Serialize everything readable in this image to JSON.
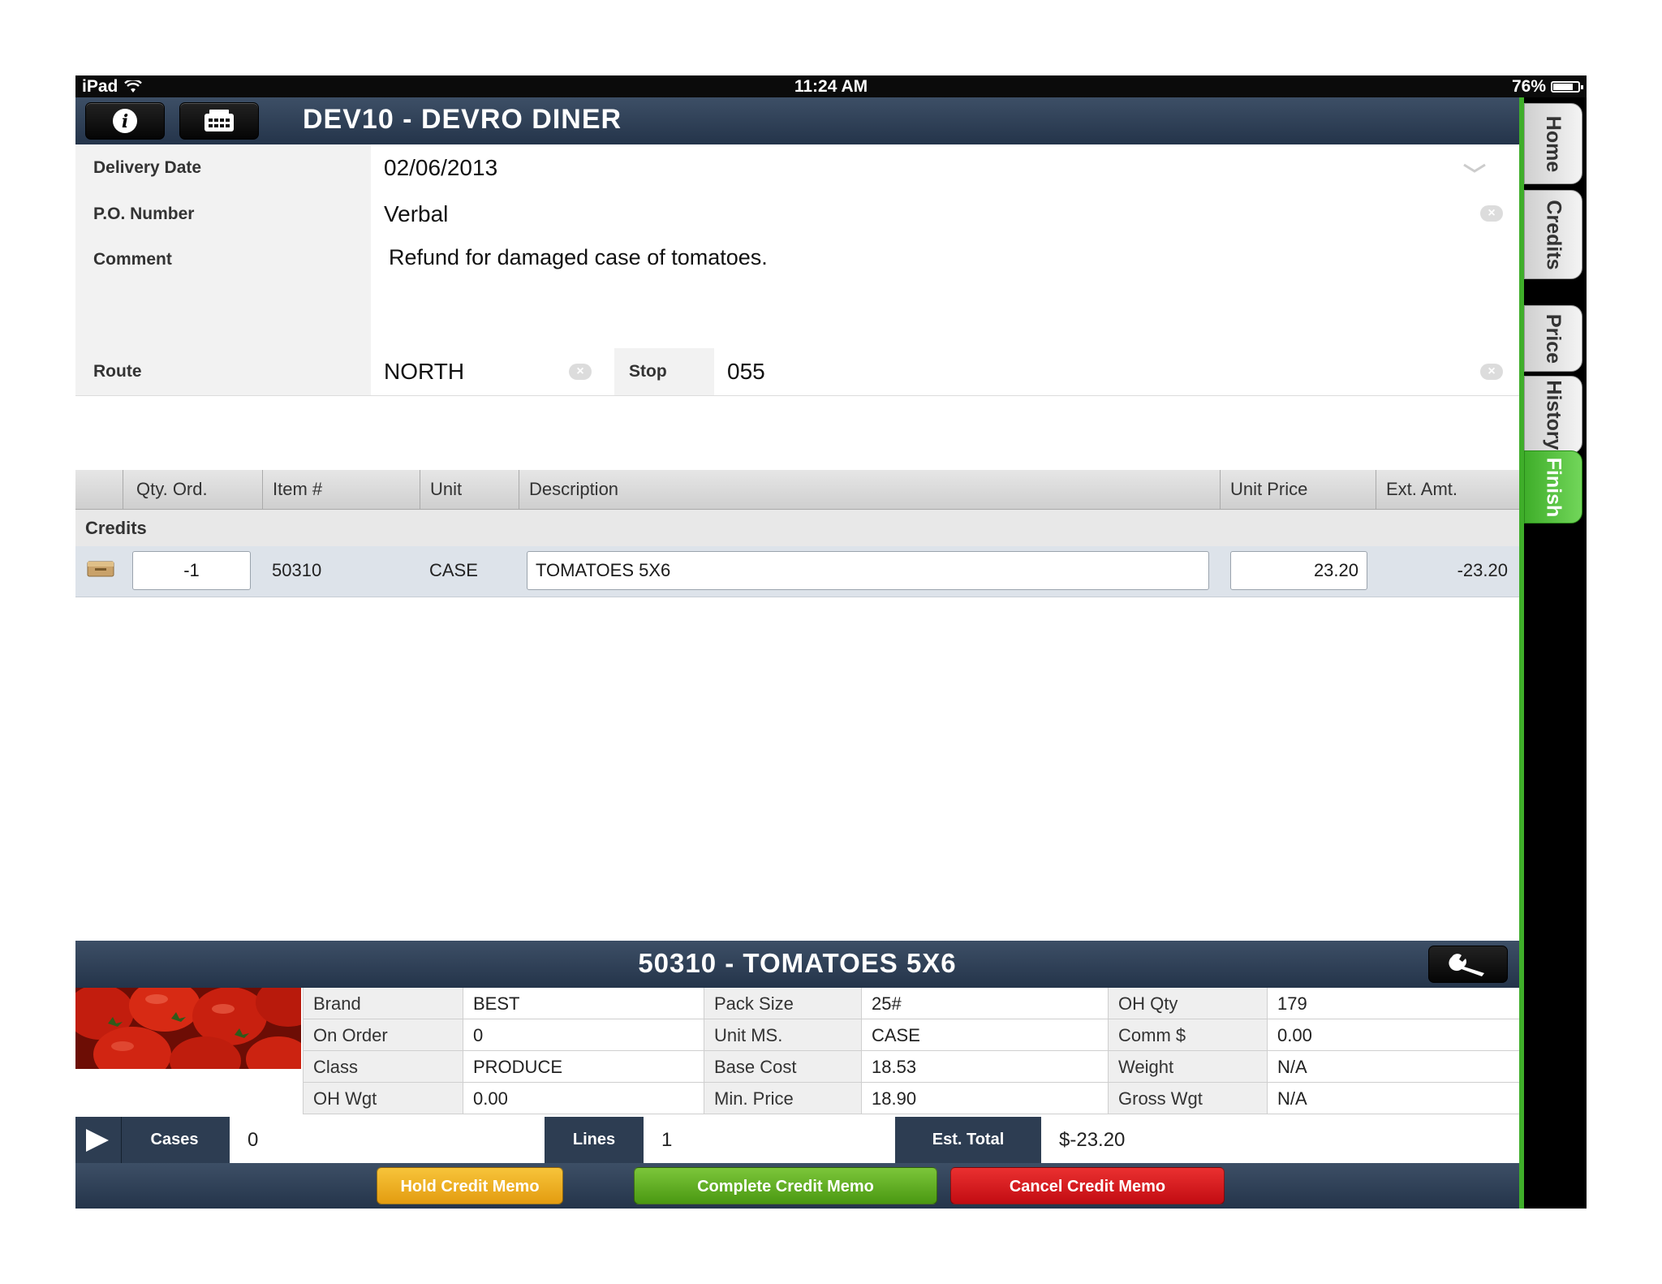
{
  "status_bar": {
    "device": "iPad",
    "time": "11:24 AM",
    "battery": "76%",
    "battery_level": 0.76
  },
  "header": {
    "title": "DEV10 - DEVRO DINER",
    "info_icon": "info-icon",
    "calculator_icon": "calculator-icon"
  },
  "form": {
    "delivery_date": {
      "label": "Delivery Date",
      "value": "02/06/2013"
    },
    "po_number": {
      "label": "P.O. Number",
      "value": "Verbal"
    },
    "comment": {
      "label": "Comment",
      "value": "Refund for damaged case of tomatoes."
    },
    "route": {
      "label": "Route",
      "value": "NORTH"
    },
    "stop": {
      "label": "Stop",
      "value": "055"
    }
  },
  "table": {
    "columns": [
      "Qty. Ord.",
      "Item #",
      "Unit",
      "Description",
      "Unit Price",
      "Ext. Amt."
    ],
    "section": "Credits",
    "rows": [
      {
        "qty": "-1",
        "item": "50310",
        "unit": "CASE",
        "description": "TOMATOES 5X6",
        "unit_price": "23.20",
        "ext_amt": "-23.20"
      }
    ]
  },
  "detail": {
    "title": "50310 - TOMATOES 5X6",
    "fields": [
      {
        "label": "Brand",
        "value": "BEST"
      },
      {
        "label": "On Order",
        "value": "0"
      },
      {
        "label": "Class",
        "value": "PRODUCE"
      },
      {
        "label": "OH Wgt",
        "value": "0.00"
      },
      {
        "label": "Pack Size",
        "value": "25#"
      },
      {
        "label": "Unit MS.",
        "value": "CASE"
      },
      {
        "label": "Base Cost",
        "value": "18.53"
      },
      {
        "label": "Min. Price",
        "value": "18.90"
      },
      {
        "label": "OH Qty",
        "value": "179"
      },
      {
        "label": "Comm $",
        "value": "0.00"
      },
      {
        "label": "Weight",
        "value": "N/A"
      },
      {
        "label": "Gross Wgt",
        "value": "N/A"
      }
    ]
  },
  "totals": {
    "cases_label": "Cases",
    "cases": "0",
    "lines_label": "Lines",
    "lines": "1",
    "est_total_label": "Est. Total",
    "est_total": "$-23.20"
  },
  "actions": {
    "hold": "Hold Credit Memo",
    "complete": "Complete Credit Memo",
    "cancel": "Cancel Credit Memo"
  },
  "side_tabs": [
    "Home",
    "Credits",
    "Price",
    "History",
    "Finish"
  ],
  "colors": {
    "header": "#2d3d52",
    "finish_green": "#3fae2a",
    "hold": "#f0b21c",
    "complete": "#5aa81e",
    "cancel": "#d4141a"
  }
}
